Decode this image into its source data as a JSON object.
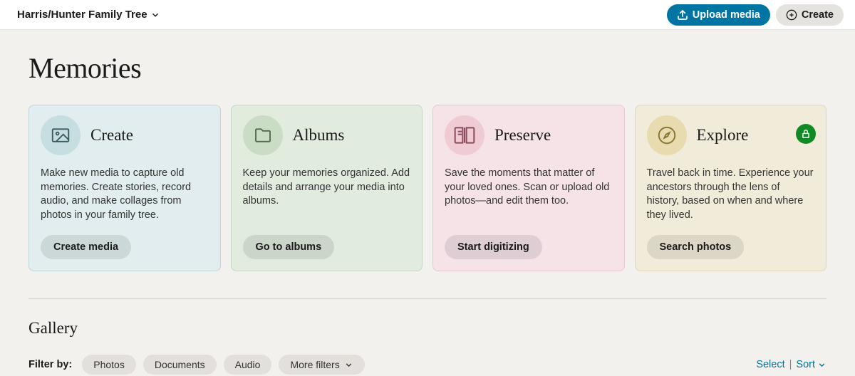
{
  "topbar": {
    "tree_name": "Harris/Hunter Family Tree",
    "upload_label": "Upload media",
    "create_label": "Create"
  },
  "page_title": "Memories",
  "cards": {
    "create": {
      "title": "Create",
      "desc": "Make new media to capture old memories. Create stories, record audio, and make collages from photos in your family tree.",
      "button": "Create media"
    },
    "albums": {
      "title": "Albums",
      "desc": "Keep your memories organized. Add details and arrange your media into albums.",
      "button": "Go to albums"
    },
    "preserve": {
      "title": "Preserve",
      "desc": "Save the moments that matter of your loved ones. Scan or upload old photos—and edit them too.",
      "button": "Start digitizing"
    },
    "explore": {
      "title": "Explore",
      "desc": "Travel back in time. Experience your ancestors through the lens of history, based on when and where they lived.",
      "button": "Search photos"
    }
  },
  "gallery": {
    "title": "Gallery",
    "filter_label": "Filter by:",
    "chips": {
      "photos": "Photos",
      "documents": "Documents",
      "audio": "Audio",
      "more": "More filters"
    },
    "select_label": "Select",
    "sort_label": "Sort"
  }
}
